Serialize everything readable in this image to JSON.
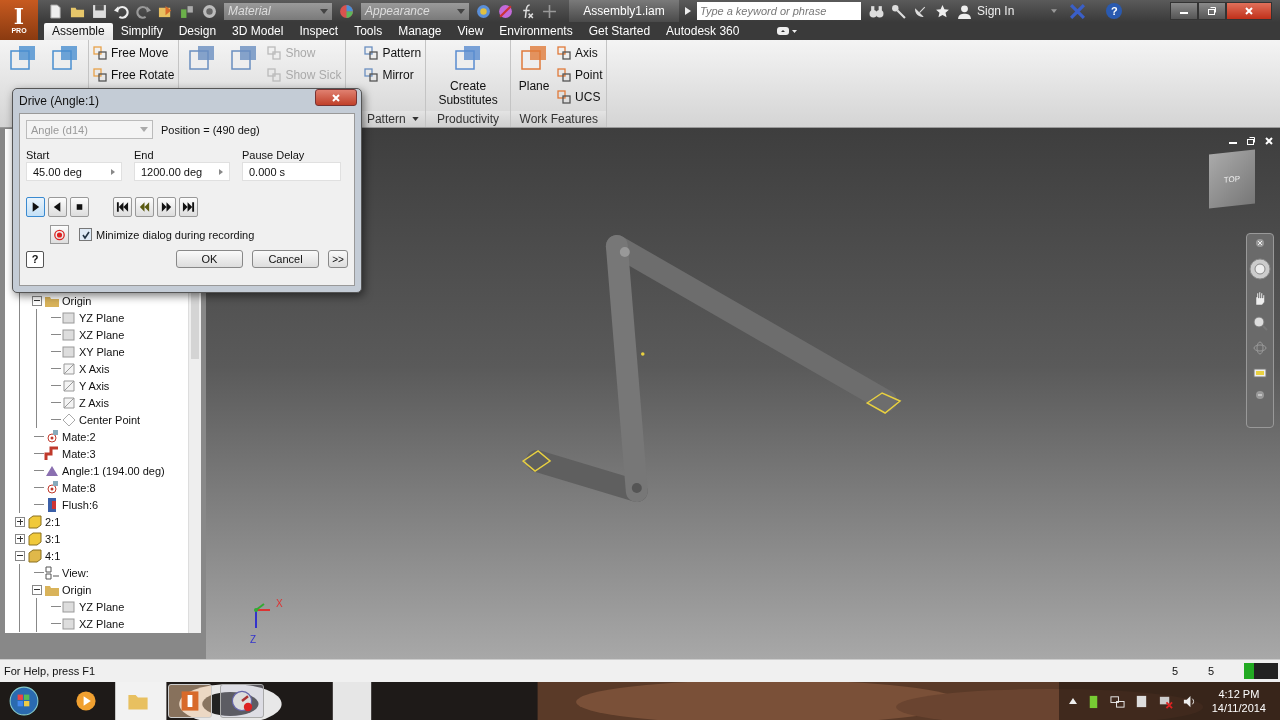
{
  "app_button": {
    "letter": "I",
    "edition": "PRO"
  },
  "quick_access": {
    "material": {
      "placeholder": "Material"
    },
    "appearance": {
      "placeholder": "Appearance"
    }
  },
  "window": {
    "title": "Assembly1.iam"
  },
  "search": {
    "placeholder": "Type a keyword or phrase"
  },
  "sign_in": "Sign In",
  "help": "?",
  "tabs": [
    {
      "label": "Assemble",
      "selected": true
    },
    {
      "label": "Simplify",
      "selected": false
    },
    {
      "label": "Design",
      "selected": false
    },
    {
      "label": "3D Model",
      "selected": false
    },
    {
      "label": "Inspect",
      "selected": false
    },
    {
      "label": "Tools",
      "selected": false
    },
    {
      "label": "Manage",
      "selected": false
    },
    {
      "label": "View",
      "selected": false
    },
    {
      "label": "Environments",
      "selected": false
    },
    {
      "label": "Get Started",
      "selected": false
    },
    {
      "label": "Autodesk 360",
      "selected": false
    }
  ],
  "ribbon_panels": [
    {
      "buttons": [
        {
          "kind": "large",
          "disabled": false
        },
        {
          "kind": "large",
          "disabled": false
        }
      ]
    },
    {
      "buttons": [
        {
          "label": "Free Move",
          "kind": "small",
          "disabled": false
        },
        {
          "label": "Free Rotate",
          "kind": "small",
          "disabled": false
        }
      ]
    },
    {
      "buttons": [
        {
          "kind": "large",
          "disabled": false
        },
        {
          "kind": "large",
          "disabled": false
        },
        {
          "label": "Show",
          "kind": "small",
          "disabled": true
        },
        {
          "label": "Show Sick",
          "kind": "small",
          "disabled": true
        }
      ]
    },
    {
      "label": "Pattern",
      "dropdown": true,
      "buttons": [
        {
          "label": "Pattern",
          "kind": "small",
          "disabled": false
        },
        {
          "label": "Mirror",
          "kind": "small",
          "disabled": false
        }
      ]
    },
    {
      "label": "Productivity",
      "dropdown": false,
      "buttons": [
        {
          "label": "Create Substitutes",
          "kind": "large",
          "disabled": false
        }
      ]
    },
    {
      "label": "Work Features",
      "dropdown": false,
      "buttons": [
        {
          "label": "Plane",
          "kind": "large",
          "disabled": false
        },
        {
          "label": "Axis",
          "kind": "small",
          "disabled": false
        },
        {
          "label": "Point",
          "kind": "small",
          "disabled": false
        },
        {
          "label": "UCS",
          "kind": "small",
          "disabled": false
        }
      ]
    }
  ],
  "tree": {
    "upper_branch": [
      {
        "label": "Origin",
        "kind": "folder",
        "expanded": true,
        "children": [
          {
            "label": "YZ Plane",
            "kind": "plane"
          },
          {
            "label": "XZ Plane",
            "kind": "plane"
          },
          {
            "label": "XY Plane",
            "kind": "plane"
          },
          {
            "label": "X Axis",
            "kind": "axis"
          },
          {
            "label": "Y Axis",
            "kind": "axis"
          },
          {
            "label": "Z Axis",
            "kind": "axis"
          },
          {
            "label": "Center Point",
            "kind": "point"
          }
        ]
      },
      {
        "label": "Mate:2",
        "kind": "mate"
      },
      {
        "label": "Mate:3",
        "kind": "mate-flush"
      },
      {
        "label": "Angle:1 (194.00 deg)",
        "kind": "angle"
      },
      {
        "label": "Mate:8",
        "kind": "mate"
      },
      {
        "label": "Flush:6",
        "kind": "flush"
      }
    ],
    "items": [
      {
        "label": "2:1",
        "kind": "part",
        "expanded": false
      },
      {
        "label": "3:1",
        "kind": "part",
        "expanded": false
      },
      {
        "label": "4:1",
        "kind": "part-adaptive",
        "expanded": true,
        "children": [
          {
            "label": "View:",
            "kind": "view"
          },
          {
            "label": "Origin",
            "kind": "folder",
            "expanded": true,
            "children": [
              {
                "label": "YZ Plane",
                "kind": "plane"
              },
              {
                "label": "XZ Plane",
                "kind": "plane"
              }
            ]
          }
        ]
      }
    ]
  },
  "viewport": {
    "view_cube": "TOP",
    "axes": [
      "X",
      "Z"
    ]
  },
  "dialog": {
    "title": "Drive (Angle:1)",
    "parameter": {
      "value": "Angle (d14)",
      "disabled": true
    },
    "position": "Position = (490 deg)",
    "fields": [
      {
        "label": "Start",
        "value": "45.00 deg",
        "arrow": true
      },
      {
        "label": "End",
        "value": "1200.00 deg",
        "arrow": true
      },
      {
        "label": "Pause Delay",
        "value": "0.000 s",
        "arrow": false
      }
    ],
    "playback": [
      {
        "kind": "forward",
        "selected": true
      },
      {
        "kind": "reverse",
        "selected": false
      },
      {
        "kind": "stop",
        "selected": false
      },
      {
        "kind": "start",
        "selected": false
      },
      {
        "kind": "step-back",
        "selected": false
      },
      {
        "kind": "step-forward",
        "selected": false
      },
      {
        "kind": "end",
        "selected": false
      }
    ],
    "minimize": {
      "label": "Minimize dialog during recording",
      "checked": true
    },
    "help": "?",
    "buttons": [
      "OK",
      "Cancel"
    ],
    "more": ">>"
  },
  "status_bar": {
    "text": "For Help, press F1",
    "counts": [
      "5",
      "5"
    ]
  },
  "taskbar": {
    "time": "4:12 PM",
    "date": "14/11/2014"
  }
}
